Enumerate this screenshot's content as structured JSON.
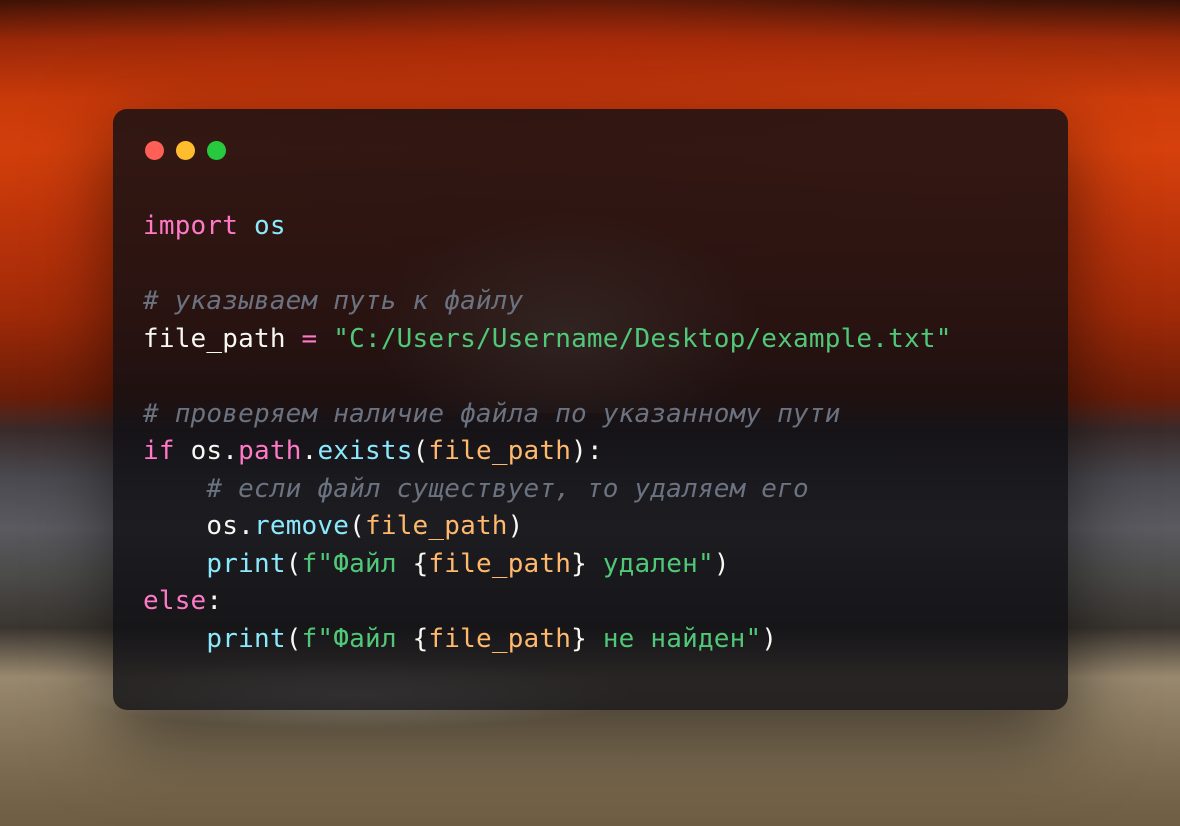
{
  "code": {
    "line1": {
      "import_kw": "import",
      "module": "os"
    },
    "line3": {
      "comment": "# указываем путь к файлу"
    },
    "line4": {
      "var": "file_path",
      "op": "=",
      "string": "\"C:/Users/Username/Desktop/example.txt\""
    },
    "line6": {
      "comment": "# проверяем наличие файла по указанному пути"
    },
    "line7": {
      "if_kw": "if",
      "obj": "os",
      "dot1": ".",
      "attr": "path",
      "dot2": ".",
      "method": "exists",
      "open": "(",
      "arg": "file_path",
      "close": "):"
    },
    "line8": {
      "comment": "    # если файл существует, то удаляем его"
    },
    "line9": {
      "indent": "    ",
      "obj": "os",
      "dot": ".",
      "method": "remove",
      "open": "(",
      "arg": "file_path",
      "close": ")"
    },
    "line10": {
      "indent": "    ",
      "func": "print",
      "open": "(",
      "fprefix": "f\"",
      "text1": "Файл ",
      "brace_open": "{",
      "var": "file_path",
      "brace_close": "}",
      "text2": " удален",
      "fend": "\"",
      "close": ")"
    },
    "line11": {
      "else_kw": "else",
      "colon": ":"
    },
    "line12": {
      "indent": "    ",
      "func": "print",
      "open": "(",
      "fprefix": "f\"",
      "text1": "Файл ",
      "brace_open": "{",
      "var": "file_path",
      "brace_close": "}",
      "text2": " не найден",
      "fend": "\"",
      "close": ")"
    }
  }
}
